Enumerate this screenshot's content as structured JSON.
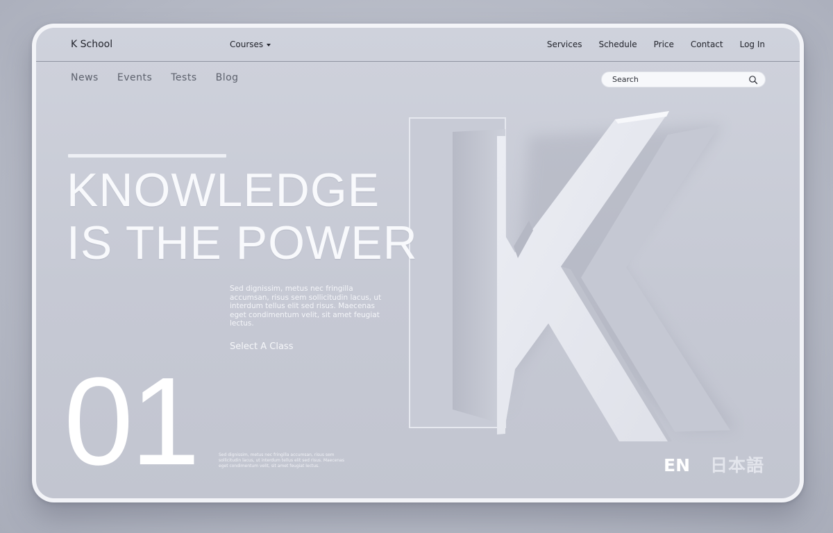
{
  "brand": "K School",
  "courses_menu": {
    "label": "Courses"
  },
  "top_nav": [
    "Services",
    "Schedule",
    "Price",
    "Contact",
    "Log In"
  ],
  "sub_nav": [
    "News",
    "Events",
    "Tests",
    "Blog"
  ],
  "search": {
    "placeholder": "Search"
  },
  "hero": {
    "line1": "KNOWLEDGE",
    "line2": "IS THE POWER",
    "body": "Sed dignissim, metus nec fringilla accumsan, risus sem sollicitudin lacus, ut interdum tellus elit sed risus. Maecenas eget condimentum velit, sit amet feugiat lectus.",
    "cta": "Select A Class",
    "number": "01",
    "small_text": "Sed dignissim, metus nec fringilla accumsan, risus sem sollicitudin lacus, ut interdum tellus elit sed risus. Maecenas eget condimentum velit, sit amet feugiat lectus."
  },
  "languages": {
    "en": "EN",
    "jp": "日本語"
  },
  "colors": {
    "background": "#c6c9d4",
    "frame": "#f3f4f8",
    "text_dark": "#22242c",
    "hero_text": "#f8f9fc"
  }
}
